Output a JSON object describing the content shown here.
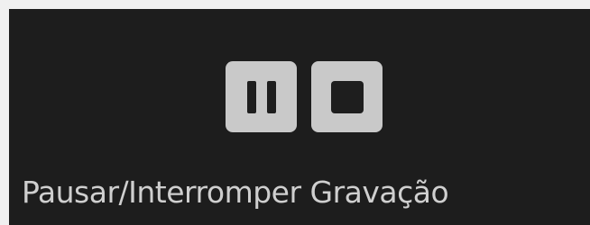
{
  "colors": {
    "panel_background": "#1d1d1d",
    "button_background": "#c9c9c9",
    "icon_color": "#1e1e1e",
    "label_color": "#cfcfcf"
  },
  "controls": {
    "pause": {
      "icon": "pause-icon"
    },
    "stop": {
      "icon": "stop-icon"
    }
  },
  "label": "Pausar/Interromper Gravação"
}
